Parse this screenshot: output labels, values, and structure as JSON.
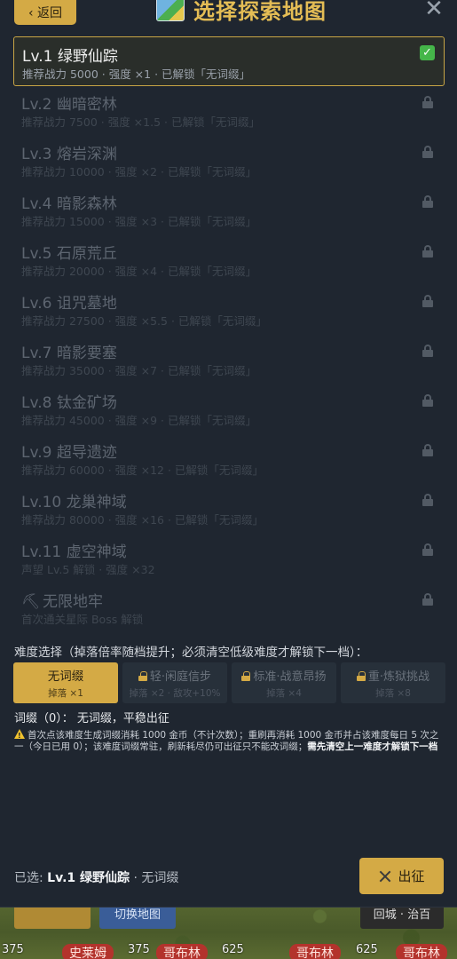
{
  "header": {
    "back_label": "‹ 返回",
    "title": "选择探索地图",
    "close_glyph": "✕"
  },
  "maps": [
    {
      "name": "Lv.1 绿野仙踪",
      "sub": "推荐战力 5000 · 强度 ×1 · 已解锁「无词缀」",
      "selected": true
    },
    {
      "name": "Lv.2 幽暗密林",
      "sub": "推荐战力 7500 · 强度 ×1.5 · 已解锁「无词缀」"
    },
    {
      "name": "Lv.3 熔岩深渊",
      "sub": "推荐战力 10000 · 强度 ×2 · 已解锁「无词缀」"
    },
    {
      "name": "Lv.4 暗影森林",
      "sub": "推荐战力 15000 · 强度 ×3 · 已解锁「无词缀」"
    },
    {
      "name": "Lv.5 石原荒丘",
      "sub": "推荐战力 20000 · 强度 ×4 · 已解锁「无词缀」"
    },
    {
      "name": "Lv.6 诅咒墓地",
      "sub": "推荐战力 27500 · 强度 ×5.5 · 已解锁「无词缀」"
    },
    {
      "name": "Lv.7 暗影要塞",
      "sub": "推荐战力 35000 · 强度 ×7 · 已解锁「无词缀」"
    },
    {
      "name": "Lv.8 钛金矿场",
      "sub": "推荐战力 45000 · 强度 ×9 · 已解锁「无词缀」"
    },
    {
      "name": "Lv.9 超导遗迹",
      "sub": "推荐战力 60000 · 强度 ×12 · 已解锁「无词缀」"
    },
    {
      "name": "Lv.10 龙巢神域",
      "sub": "推荐战力 80000 · 强度 ×16 · 已解锁「无词缀」"
    },
    {
      "name": "Lv.11 虚空神域",
      "sub": "声望 Lv.5 解锁 · 强度 ×32"
    },
    {
      "name": "无限地牢",
      "sub": "首次通关星际 Boss 解锁",
      "icon": "pickaxe-icon",
      "icon_glyph": "⛏"
    }
  ],
  "difficulty": {
    "title": "难度选择（掉落倍率随档提升；必须清空低级难度才解锁下一档）：",
    "options": [
      {
        "name": "无词缀",
        "sub": "掉落 ×1",
        "active": true
      },
      {
        "name": "轻·闲庭信步",
        "sub": "掉落 ×2 · 敌攻+10%",
        "locked": true
      },
      {
        "name": "标准·战意昂扬",
        "sub": "掉落 ×4",
        "locked": true
      },
      {
        "name": "重·炼狱挑战",
        "sub": "掉落 ×8",
        "locked": true
      }
    ],
    "affix_line": "词缀（0）：  无词缀，平稳出征",
    "note_main": "首次点该难度生成词缀消耗 1000 金币（不计次数）；重刷再消耗 1000 金币并占该难度每日 5 次之一（今日已用 0）；该难度词缀常驻，刷新耗尽仍可出征只不能改词缀；",
    "note_bold": "需先清空上一难度才解锁下一档"
  },
  "footer": {
    "selected_prefix": "已选: ",
    "selected_map": "Lv.1 绿野仙踪",
    "selected_suffix": " · 无词缀",
    "go_label": "出征"
  },
  "background": {
    "btn_left": "",
    "btn_mid": "切换地图",
    "btn_right": "回城 · 治百",
    "labels": [
      "375",
      "史莱姆",
      "375",
      "哥布林",
      "625",
      "哥布林",
      "625",
      "哥布林"
    ]
  },
  "colors": {
    "accent": "#d4aa45",
    "panel_bg": "#1f2630",
    "check_green": "#45b649"
  }
}
